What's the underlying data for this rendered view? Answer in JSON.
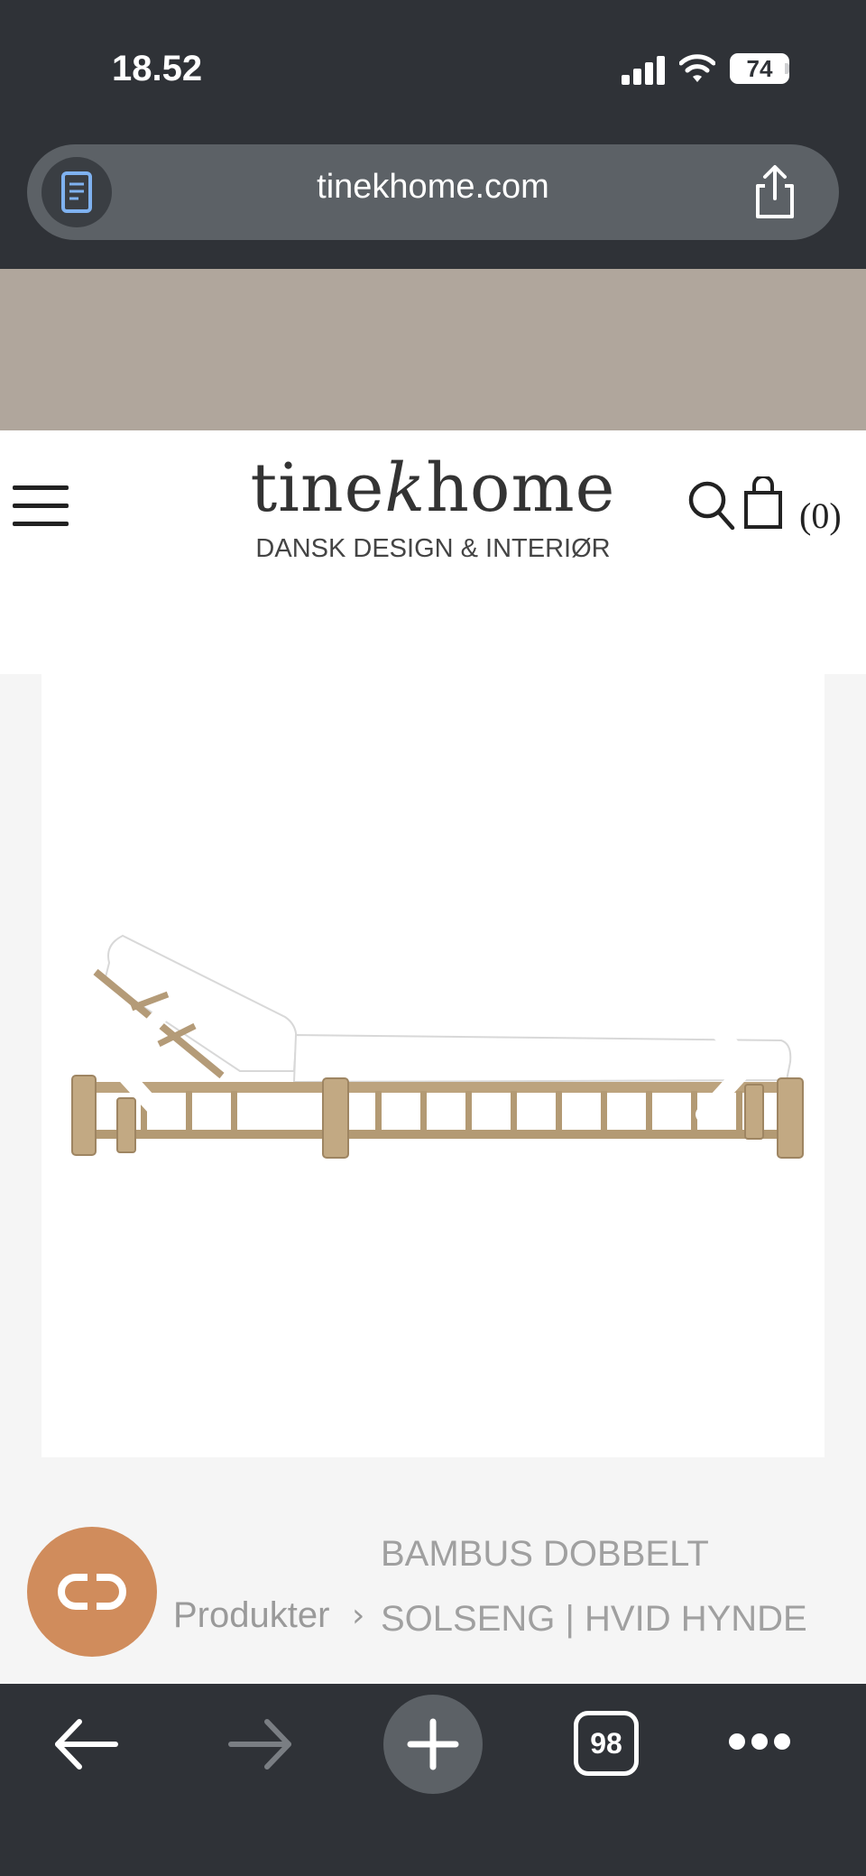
{
  "status_bar": {
    "time": "18.52",
    "battery_percent": "74",
    "battery_level": 0.74
  },
  "browser": {
    "url": "tinekhome.com",
    "reader_icon": "reader-mode-icon",
    "share_icon": "share-icon",
    "tab_count": "98"
  },
  "site": {
    "logo_part1": "tine",
    "logo_part2": "k",
    "logo_part3": "home",
    "tagline": "DANSK DESIGN & INTERIØR",
    "cart_count": "(0)",
    "banner_color": "#b0a69c"
  },
  "product": {
    "breadcrumb_root": "Produkter",
    "breadcrumb_separator": "›",
    "breadcrumb_current": "BAMBUS DOBBELT SOLSENG | HVID HYNDE",
    "image_description_icon": "daybed-image"
  },
  "colors": {
    "chrome_dark": "#2f3237",
    "pill": "#5c6166",
    "chat_accent": "#d08c5c",
    "reader_icon": "#7fb2f0"
  }
}
